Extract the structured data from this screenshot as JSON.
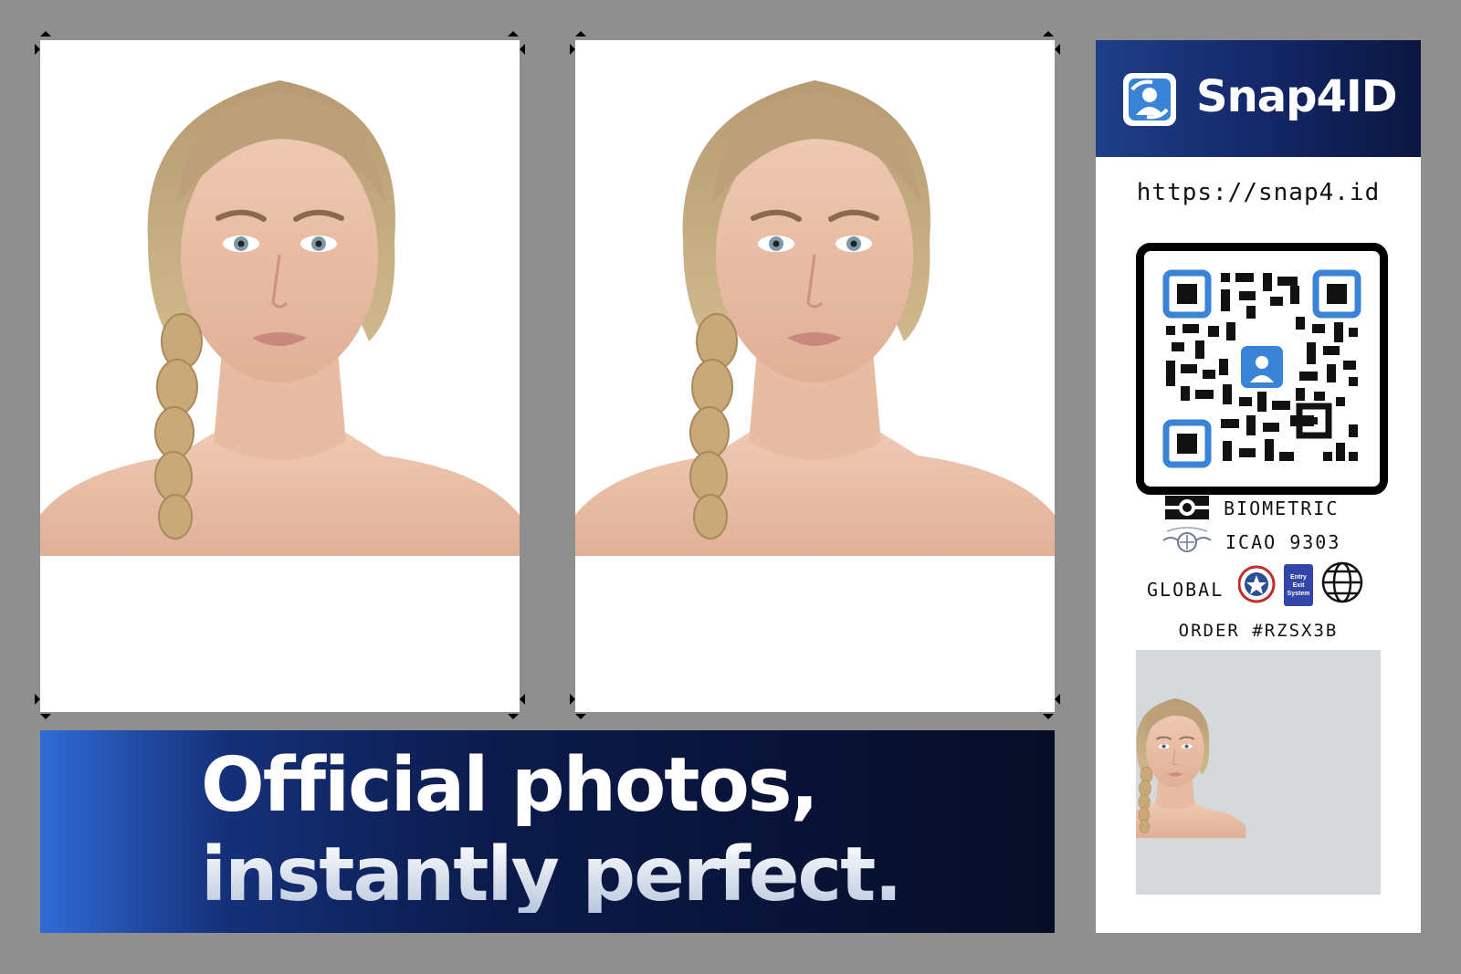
{
  "photos": [
    {
      "label": "passport-photo-1"
    },
    {
      "label": "passport-photo-2"
    }
  ],
  "banner": {
    "line1": "Official photos,",
    "line2": "instantly perfect."
  },
  "brand": {
    "name": "Snap4ID",
    "url": "https://snap4.id"
  },
  "features": {
    "biometric": "BIOMETRIC",
    "icao": "ICAO 9303",
    "global": "GLOBAL",
    "ees_badge_line1": "Entry",
    "ees_badge_line2": "Exit",
    "ees_badge_line3": "System"
  },
  "order": "ORDER #RZSX3B",
  "colors": {
    "page_background": "#8f8f8f",
    "brand_blue": "#1f3f87",
    "qr_accent": "#3a84d8",
    "banner_dark": "#070d26"
  },
  "icons": [
    "camera-icon",
    "icao-emblem-icon",
    "star-seal-icon",
    "ees-badge-icon",
    "globe-icon",
    "snap4id-logo-icon"
  ]
}
